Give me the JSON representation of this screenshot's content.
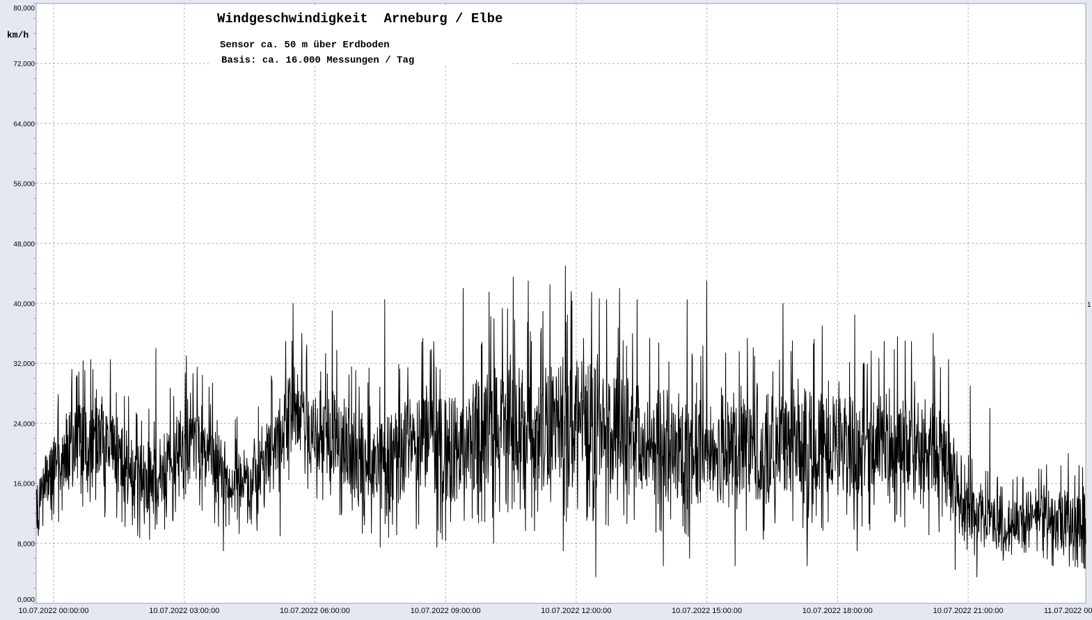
{
  "chart_data": {
    "type": "line",
    "title": "Windgeschwindigkeit  Arneburg / Elbe",
    "subtitle_1": "Sensor ca. 50 m über Erdboden",
    "subtitle_2": "Basis: ca. 16.000 Messungen / Tag",
    "ylabel": "km/h",
    "ylim": [
      0,
      80
    ],
    "grid": true,
    "ytick_labels": [
      "0,000",
      "8,000",
      "16,000",
      "24,000",
      "32,000",
      "40,000",
      "48,000",
      "56,000",
      "64,000",
      "72,000",
      "80,000"
    ],
    "ytick_values": [
      0,
      8,
      16,
      24,
      32,
      40,
      48,
      56,
      64,
      72,
      80
    ],
    "xlim_hours": [
      -0.4,
      23.7
    ],
    "xtick_hours": [
      0,
      3,
      6,
      9,
      12,
      15,
      18,
      21,
      24
    ],
    "xtick_labels": [
      "10.07.2022  00:00:00",
      "10.07.2022  03:00:00",
      "10.07.2022  06:00:00",
      "10.07.2022  09:00:00",
      "10.07.2022  12:00:00",
      "10.07.2022  15:00:00",
      "10.07.2022  18:00:00",
      "10.07.2022  21:00:00",
      "11.07.2022  00:00:00"
    ],
    "right_edge_label": "1",
    "series": [
      {
        "color": "#000000",
        "x_hours": [
          -0.4,
          0.0,
          0.5,
          1.0,
          1.5,
          2.0,
          2.5,
          3.0,
          3.5,
          4.0,
          4.5,
          5.0,
          5.5,
          6.0,
          6.5,
          7.0,
          7.5,
          8.0,
          8.5,
          9.0,
          9.5,
          10.0,
          10.5,
          11.0,
          11.5,
          12.0,
          12.5,
          13.0,
          13.5,
          14.0,
          14.5,
          15.0,
          15.5,
          16.0,
          16.5,
          17.0,
          17.5,
          18.0,
          18.5,
          19.0,
          19.5,
          20.0,
          20.5,
          21.0,
          21.5,
          22.0,
          22.5,
          23.0,
          23.5,
          23.7
        ],
        "mean_kmh": [
          14,
          18,
          21,
          22,
          19,
          16,
          17,
          22,
          21,
          16,
          16,
          20,
          26,
          22,
          21,
          19,
          19,
          20,
          21,
          20,
          21,
          24,
          24,
          22,
          24,
          25,
          24,
          23,
          21,
          21,
          20,
          21,
          21,
          21,
          20,
          22,
          21,
          22,
          20,
          22,
          21,
          21,
          18,
          13,
          11,
          10,
          12,
          11,
          11,
          11
        ],
        "spread_kmh": [
          4,
          6,
          7,
          8,
          7,
          6,
          6,
          7,
          7,
          6,
          6,
          7,
          7,
          7,
          8,
          8,
          8,
          9,
          9,
          9,
          9,
          10,
          10,
          10,
          10,
          11,
          11,
          10,
          9,
          9,
          9,
          9,
          9,
          9,
          9,
          9,
          9,
          9,
          9,
          9,
          9,
          9,
          8,
          5,
          4,
          4,
          4,
          5,
          5,
          5
        ],
        "peaks": [
          [
            0.1,
            26
          ],
          [
            0.85,
            32.5
          ],
          [
            1.3,
            32.5
          ],
          [
            2.35,
            34
          ],
          [
            3.05,
            33
          ],
          [
            3.3,
            31.5
          ],
          [
            5.5,
            40
          ],
          [
            5.7,
            36
          ],
          [
            6.4,
            39
          ],
          [
            7.6,
            40.5
          ],
          [
            9.4,
            42
          ],
          [
            10.0,
            41.5
          ],
          [
            10.55,
            43.5
          ],
          [
            10.9,
            43
          ],
          [
            11.4,
            42.5
          ],
          [
            11.75,
            45
          ],
          [
            12.35,
            41.5
          ],
          [
            12.7,
            40.5
          ],
          [
            13.0,
            42
          ],
          [
            13.4,
            40.5
          ],
          [
            14.55,
            40.5
          ],
          [
            15.0,
            43
          ],
          [
            16.75,
            40
          ],
          [
            17.65,
            37
          ],
          [
            18.4,
            38.5
          ],
          [
            19.55,
            35
          ],
          [
            20.2,
            36
          ],
          [
            20.55,
            32.5
          ],
          [
            21.05,
            29
          ],
          [
            21.5,
            26
          ],
          [
            22.8,
            18.5
          ],
          [
            23.3,
            20
          ]
        ],
        "troughs": [
          [
            -0.35,
            9
          ],
          [
            2.2,
            8.5
          ],
          [
            3.9,
            7
          ],
          [
            5.2,
            9
          ],
          [
            7.5,
            7.5
          ],
          [
            8.8,
            7.5
          ],
          [
            10.1,
            8
          ],
          [
            11.7,
            7
          ],
          [
            12.45,
            3.5
          ],
          [
            14.0,
            5
          ],
          [
            14.6,
            6
          ],
          [
            15.65,
            5
          ],
          [
            16.3,
            8.5
          ],
          [
            17.3,
            5
          ],
          [
            18.45,
            7
          ],
          [
            20.7,
            4.5
          ],
          [
            21.2,
            3.5
          ],
          [
            22.0,
            6.5
          ],
          [
            22.95,
            5
          ],
          [
            23.6,
            5.5
          ]
        ],
        "noise_seed": 7,
        "samples": 3000
      }
    ]
  }
}
